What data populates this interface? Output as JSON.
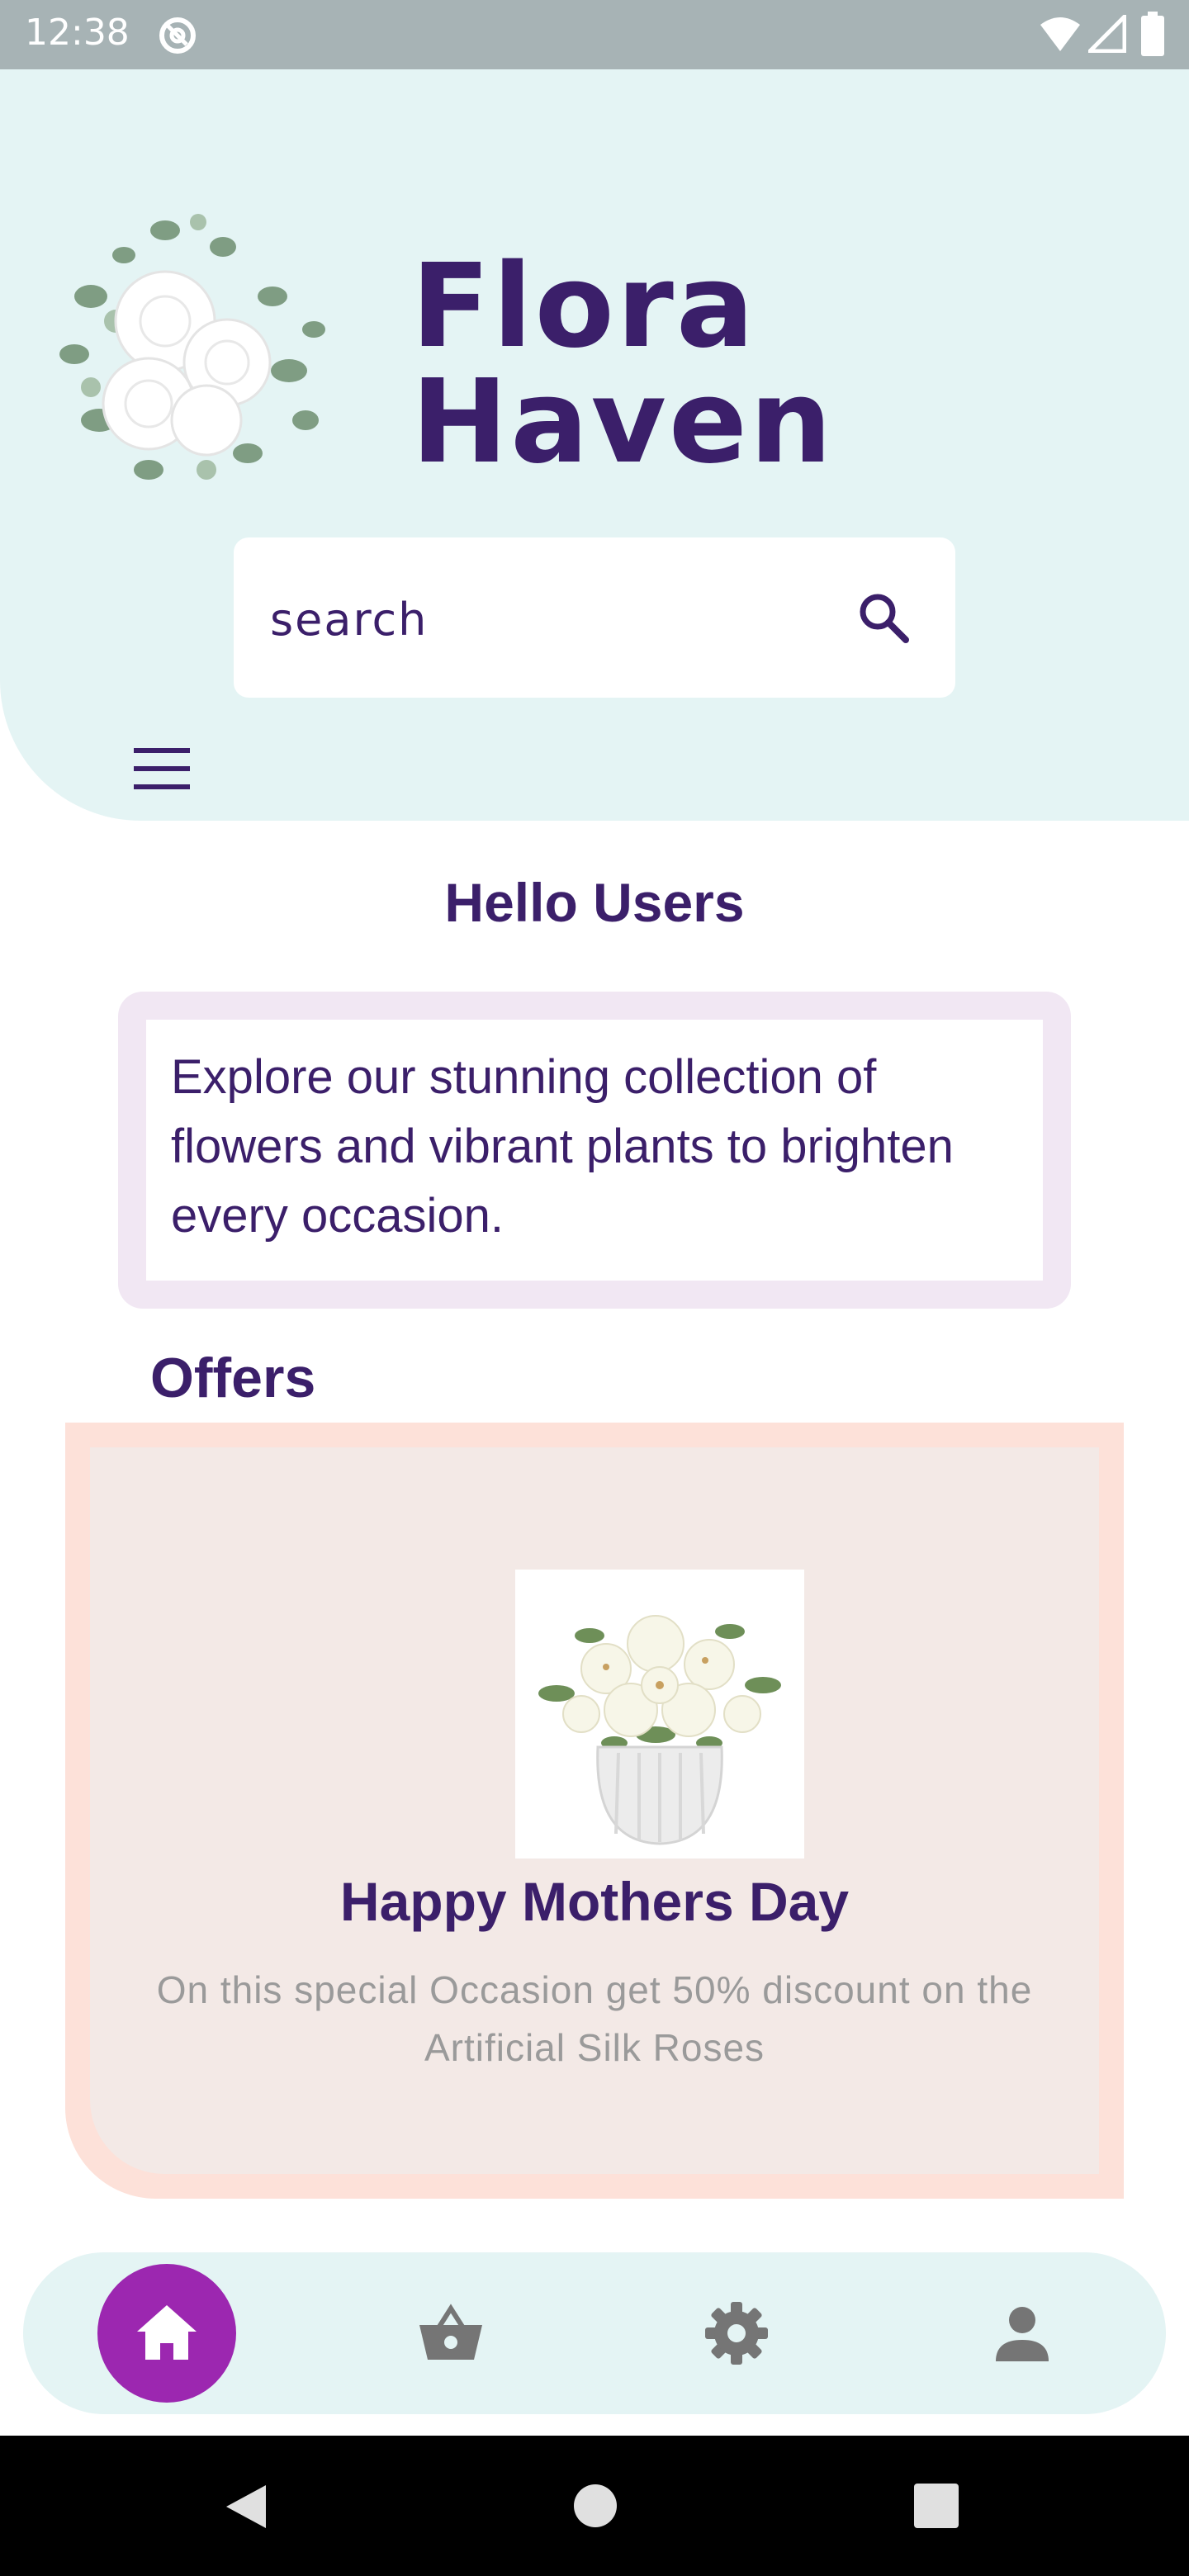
{
  "status_bar": {
    "time": "12:38"
  },
  "header": {
    "app_title": "Flora Haven",
    "search": {
      "placeholder": "search",
      "value": ""
    }
  },
  "main": {
    "greeting": "Hello Users",
    "intro_text": "Explore our stunning collection of flowers and vibrant plants to brighten every occasion.",
    "offers_heading": "Offers",
    "offer": {
      "title": "Happy Mothers Day",
      "description": "On this special Occasion get 50% discount on the Artificial Silk Roses"
    }
  },
  "bottom_nav": {
    "items": [
      {
        "icon": "home-icon",
        "active": true
      },
      {
        "icon": "basket-icon",
        "active": false
      },
      {
        "icon": "gear-icon",
        "active": false
      },
      {
        "icon": "person-icon",
        "active": false
      }
    ],
    "active_color": "#9c27b0"
  },
  "colors": {
    "primary_text": "#3b1f6a",
    "header_bg": "#e4f4f4",
    "offer_border": "#fde1d9",
    "intro_border": "#f1e7f3"
  }
}
